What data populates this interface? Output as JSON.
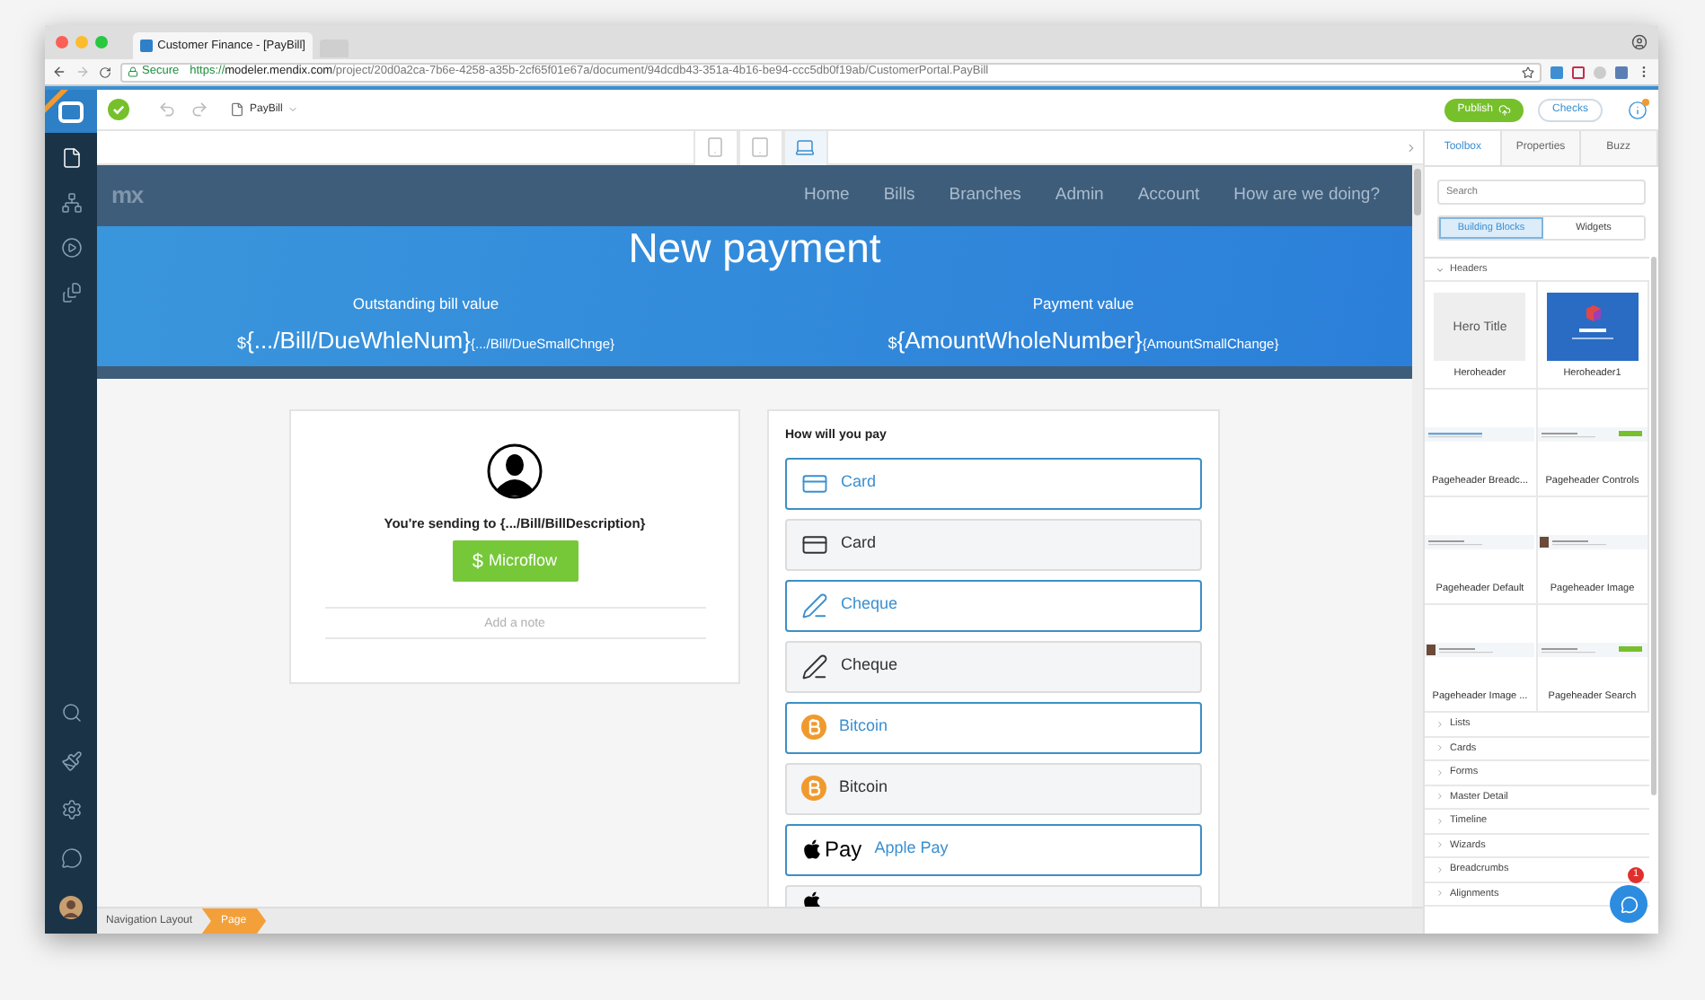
{
  "browser": {
    "tab_title": "Customer Finance - [PayBill]",
    "secure_label": "Secure",
    "url_scheme": "https://",
    "url_host": "modeler.mendix.com",
    "url_path": "/project/20d0a2ca-7b6e-4258-a35b-2cf65f01e67a/document/94dcdb43-351a-4b16-be94-ccc5db0f19ab/CustomerPortal.PayBill"
  },
  "toolbar": {
    "document": "PayBill",
    "publish": "Publish",
    "checks": "Checks"
  },
  "devices": [
    {
      "kind": "phone",
      "selected": false
    },
    {
      "kind": "tablet",
      "selected": false
    },
    {
      "kind": "desktop",
      "selected": true
    }
  ],
  "page": {
    "logo": "mx",
    "nav": [
      "Home",
      "Bills",
      "Branches",
      "Admin",
      "Account",
      "How are we doing?"
    ],
    "title": "New payment",
    "values": [
      {
        "label": "Outstanding bill value",
        "currency": "$",
        "main": "{.../Bill/DueWhleNum}",
        "small": "{.../Bill/DueSmallChnge}"
      },
      {
        "label": "Payment value",
        "currency": "$",
        "main": "{AmountWholeNumber}",
        "small": "{AmountSmallChange}"
      }
    ],
    "send_card": {
      "text": "You're sending to {.../Bill/BillDescription}",
      "currency": "$",
      "button": "Microflow",
      "note_placeholder": "Add a note"
    },
    "pay_card": {
      "heading": "How will you pay",
      "options": [
        {
          "kind": "card",
          "label": "Card"
        },
        {
          "kind": "card",
          "label": "Card"
        },
        {
          "kind": "cheque",
          "label": "Cheque"
        },
        {
          "kind": "cheque",
          "label": "Cheque"
        },
        {
          "kind": "bitcoin",
          "label": "Bitcoin"
        },
        {
          "kind": "bitcoin",
          "label": "Bitcoin"
        },
        {
          "kind": "applepay",
          "logo_text": "Pay",
          "label": "Apple Pay"
        },
        {
          "kind": "applepay"
        }
      ]
    }
  },
  "breadcrumb": [
    {
      "label": "Navigation Layout",
      "selected": false
    },
    {
      "label": "Page",
      "selected": true
    }
  ],
  "panel": {
    "tabs": [
      {
        "label": "Toolbox",
        "selected": true
      },
      {
        "label": "Properties",
        "selected": false
      },
      {
        "label": "Buzz",
        "selected": false
      }
    ],
    "search_placeholder": "Search",
    "modes": [
      {
        "label": "Building Blocks",
        "selected": true
      },
      {
        "label": "Widgets",
        "selected": false
      }
    ],
    "section": {
      "label": "Headers",
      "expanded": true
    },
    "blocks": [
      {
        "label": "Heroheader",
        "kind": "hero",
        "thumb_title": "Hero Title"
      },
      {
        "label": "Heroheader1",
        "kind": "hero_image"
      },
      {
        "label": "Pageheader Breadc...",
        "kind": "breadcrumbs"
      },
      {
        "label": "Pageheader Controls",
        "kind": "controls"
      },
      {
        "label": "Pageheader Default",
        "kind": "default"
      },
      {
        "label": "Pageheader Image",
        "kind": "image"
      },
      {
        "label": "Pageheader Image ...",
        "kind": "image"
      },
      {
        "label": "Pageheader Search",
        "kind": "controls"
      }
    ],
    "categories": [
      "Lists",
      "Cards",
      "Forms",
      "Master Detail",
      "Timeline",
      "Wizards",
      "Breadcrumbs",
      "Alignments"
    ],
    "chat_badge": "1"
  }
}
